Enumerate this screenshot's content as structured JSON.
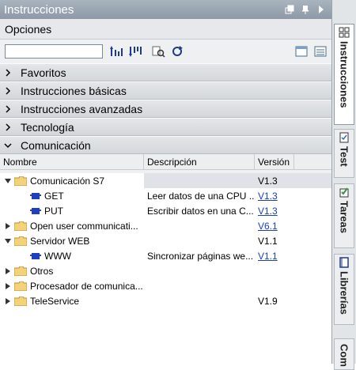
{
  "panel": {
    "title": "Instrucciones"
  },
  "options_header": "Opciones",
  "search": {
    "value": ""
  },
  "sections": [
    {
      "label": "Favoritos",
      "expanded": false
    },
    {
      "label": "Instrucciones básicas",
      "expanded": false
    },
    {
      "label": "Instrucciones avanzadas",
      "expanded": false
    },
    {
      "label": "Tecnología",
      "expanded": false
    },
    {
      "label": "Comunicación",
      "expanded": true
    }
  ],
  "columns": {
    "name": "Nombre",
    "description": "Descripción",
    "version": "Versión"
  },
  "rows": [
    {
      "name": "Comunicación S7",
      "description": "",
      "version": "V1.3",
      "version_link": false
    },
    {
      "name": "GET",
      "description": "Leer datos de una CPU ...",
      "version": "V1.3",
      "version_link": true
    },
    {
      "name": "PUT",
      "description": "Escribir datos en una C...",
      "version": "V1.3",
      "version_link": true
    },
    {
      "name": "Open user communicati...",
      "description": "",
      "version": "V6.1",
      "version_link": true
    },
    {
      "name": "Servidor WEB",
      "description": "",
      "version": "V1.1",
      "version_link": false
    },
    {
      "name": "WWW",
      "description": "Sincronizar páginas we...",
      "version": "V1.1",
      "version_link": true
    },
    {
      "name": "Otros",
      "description": "",
      "version": "",
      "version_link": false
    },
    {
      "name": "Procesador de comunica...",
      "description": "",
      "version": "",
      "version_link": false
    },
    {
      "name": "TeleService",
      "description": "",
      "version": "V1.9",
      "version_link": false
    }
  ],
  "side_tabs": [
    {
      "label": "Instrucciones",
      "active": true,
      "icon": "instructions-icon"
    },
    {
      "label": "Test",
      "active": false,
      "icon": "test-icon"
    },
    {
      "label": "Tareas",
      "active": false,
      "icon": "tasks-icon"
    },
    {
      "label": "Librerías",
      "active": false,
      "icon": "library-icon"
    },
    {
      "label": "Com",
      "active": false,
      "icon": ""
    }
  ]
}
